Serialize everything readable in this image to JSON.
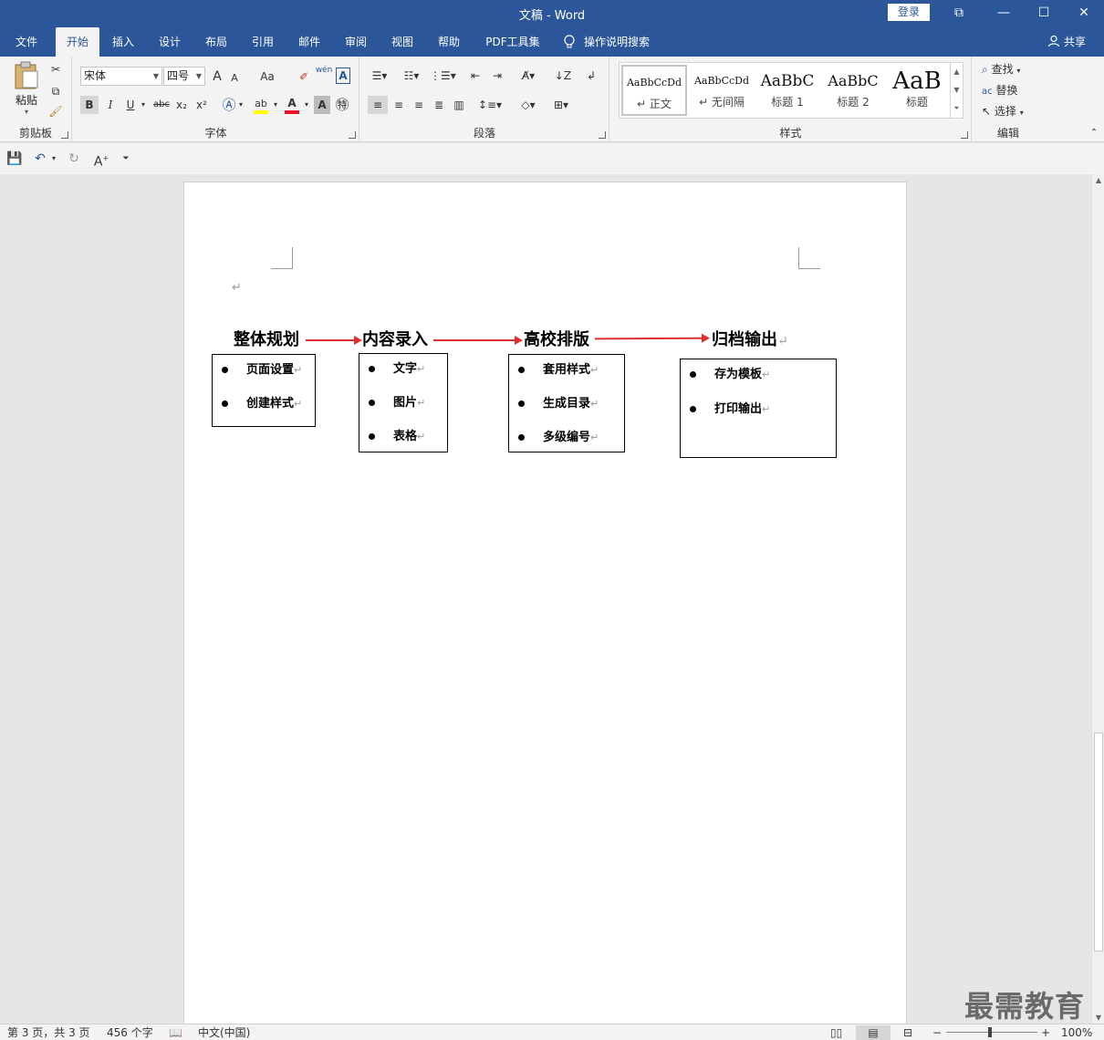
{
  "window": {
    "title": "文稿  -  Word",
    "login_label": "登录",
    "controls": [
      "⧉",
      "—",
      "☐",
      "✕"
    ]
  },
  "tabs": [
    "文件",
    "开始",
    "插入",
    "设计",
    "布局",
    "引用",
    "邮件",
    "审阅",
    "视图",
    "帮助",
    "PDF工具集"
  ],
  "tell_me": "操作说明搜索",
  "share_label": "共享",
  "ribbon": {
    "clipboard": {
      "label": "剪贴板",
      "paste_label": "粘贴"
    },
    "font": {
      "label": "字体",
      "font_name": "宋体",
      "font_size": "四号",
      "bold": "B",
      "italic": "I",
      "underline": "U",
      "strike": "abc",
      "subscript": "x₂",
      "superscript": "x²",
      "grow": "A",
      "shrink": "A",
      "case": "Aa",
      "phonetic": "wén",
      "font_color_accent": "#e81123",
      "highlight_accent": "#ffff00"
    },
    "paragraph": {
      "label": "段落"
    },
    "styles": {
      "label": "样式",
      "items": [
        {
          "preview": "AaBbCcDd",
          "name": "↵ 正文"
        },
        {
          "preview": "AaBbCcDd",
          "name": "↵ 无间隔"
        },
        {
          "preview": "AaBbC",
          "name": "标题 1"
        },
        {
          "preview": "AaBbC",
          "name": "标题 2"
        },
        {
          "preview": "AaB",
          "name": "标题"
        }
      ]
    },
    "editing": {
      "label": "编辑",
      "find": "查找",
      "replace": "替换",
      "select": "选择"
    }
  },
  "document": {
    "steps": [
      {
        "title": "整体规划",
        "items": [
          "页面设置",
          "创建样式"
        ]
      },
      {
        "title": "内容录入",
        "items": [
          "文字",
          "图片",
          "表格"
        ]
      },
      {
        "title": "高校排版",
        "items": [
          "套用样式",
          "生成目录",
          "多级编号"
        ]
      },
      {
        "title": "归档输出",
        "items": [
          "存为模板",
          "打印输出"
        ]
      }
    ],
    "para_mark": "↵",
    "arrow_color": "#e03030"
  },
  "status": {
    "page": "第 3 页，共 3 页",
    "words": "456 个字",
    "language": "中文(中国)",
    "zoom": "100%",
    "zoom_minus": "−",
    "zoom_plus": "+"
  },
  "watermark": "最需教育"
}
